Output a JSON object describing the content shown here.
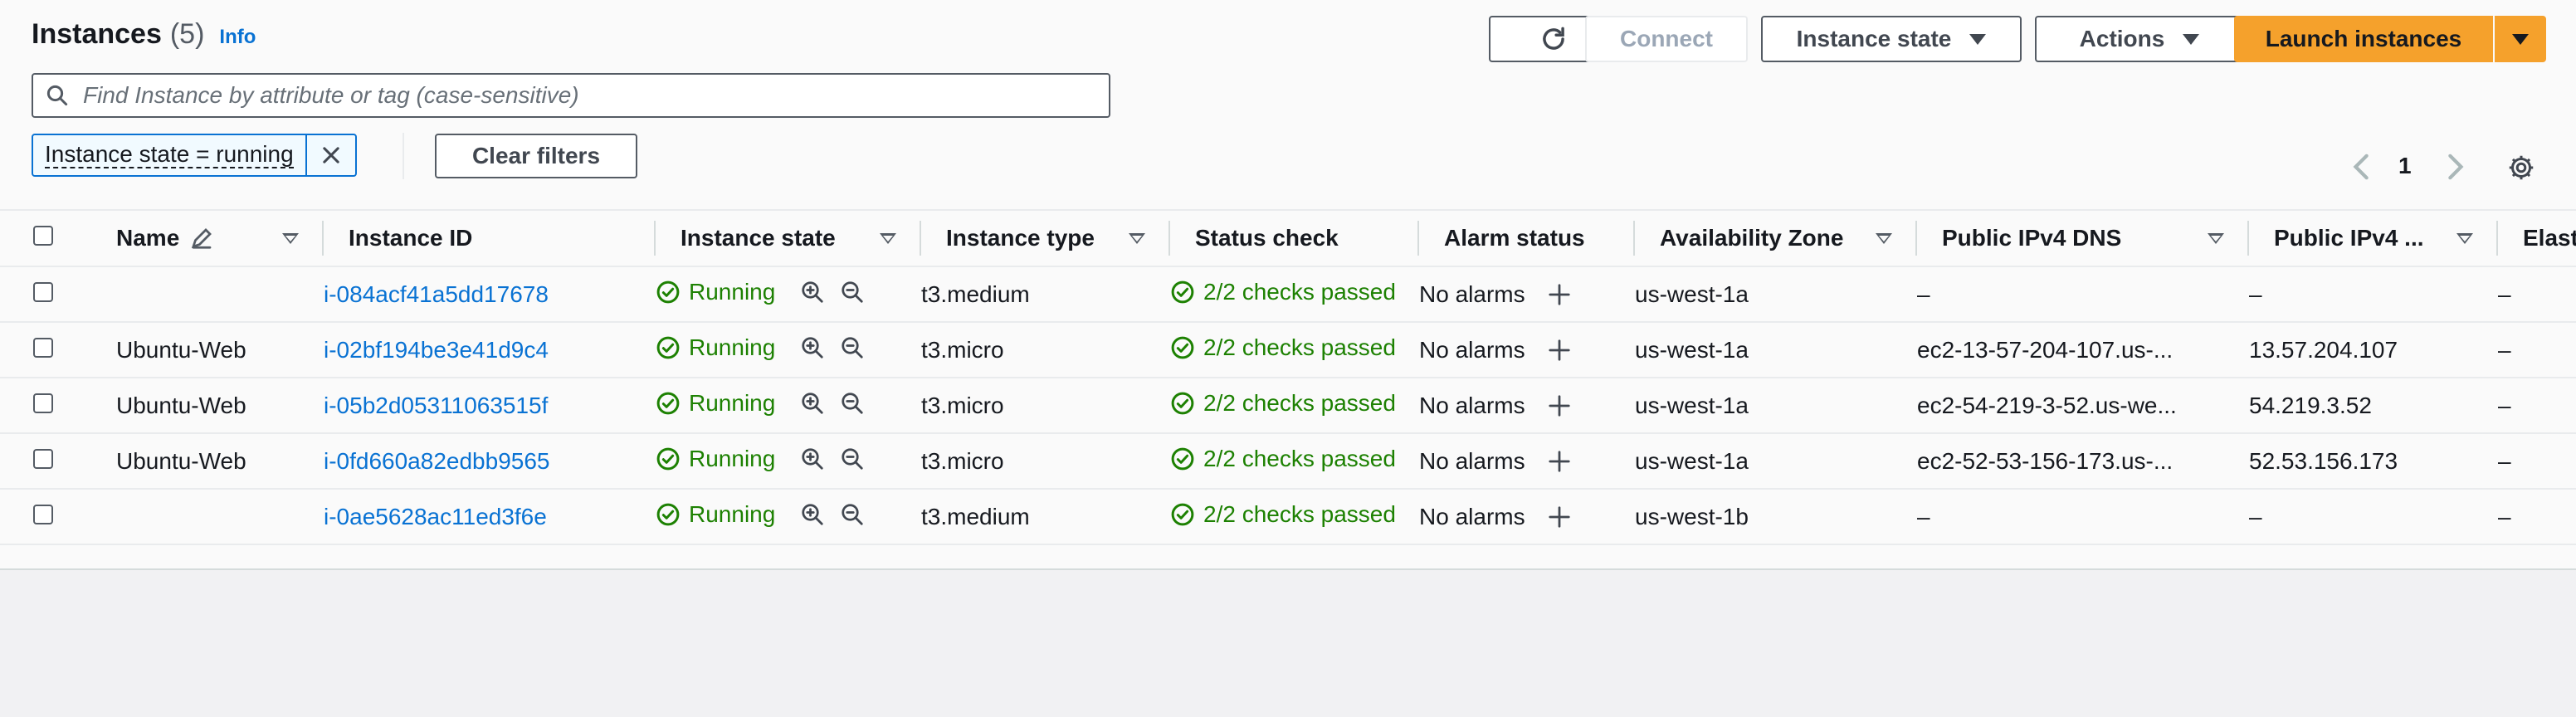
{
  "header": {
    "title": "Instances",
    "count": "(5)",
    "info_link": "Info"
  },
  "toolbar": {
    "connect_label": "Connect",
    "instance_state_label": "Instance state",
    "actions_label": "Actions",
    "launch_label": "Launch instances"
  },
  "search": {
    "placeholder": "Find Instance by attribute or tag (case-sensitive)",
    "value": ""
  },
  "filters": {
    "token_label": "Instance state = running",
    "clear_label": "Clear filters"
  },
  "pagination": {
    "current_page": "1"
  },
  "table": {
    "columns": [
      "Name",
      "Instance ID",
      "Instance state",
      "Instance type",
      "Status check",
      "Alarm status",
      "Availability Zone",
      "Public IPv4 DNS",
      "Public IPv4 ...",
      "Elast"
    ],
    "rows": [
      {
        "name": "",
        "instance_id": "i-084acf41a5dd17678",
        "state": "Running",
        "type": "t3.medium",
        "status_check": "2/2 checks passed",
        "alarm": "No alarms",
        "az": "us-west-1a",
        "dns": "–",
        "ipv4": "–",
        "elastic": "–"
      },
      {
        "name": "Ubuntu-Web",
        "instance_id": "i-02bf194be3e41d9c4",
        "state": "Running",
        "type": "t3.micro",
        "status_check": "2/2 checks passed",
        "alarm": "No alarms",
        "az": "us-west-1a",
        "dns": "ec2-13-57-204-107.us-...",
        "ipv4": "13.57.204.107",
        "elastic": "–"
      },
      {
        "name": "Ubuntu-Web",
        "instance_id": "i-05b2d05311063515f",
        "state": "Running",
        "type": "t3.micro",
        "status_check": "2/2 checks passed",
        "alarm": "No alarms",
        "az": "us-west-1a",
        "dns": "ec2-54-219-3-52.us-we...",
        "ipv4": "54.219.3.52",
        "elastic": "–"
      },
      {
        "name": "Ubuntu-Web",
        "instance_id": "i-0fd660a82edbb9565",
        "state": "Running",
        "type": "t3.micro",
        "status_check": "2/2 checks passed",
        "alarm": "No alarms",
        "az": "us-west-1a",
        "dns": "ec2-52-53-156-173.us-...",
        "ipv4": "52.53.156.173",
        "elastic": "–"
      },
      {
        "name": "",
        "instance_id": "i-0ae5628ac11ed3f6e",
        "state": "Running",
        "type": "t3.medium",
        "status_check": "2/2 checks passed",
        "alarm": "No alarms",
        "az": "us-west-1b",
        "dns": "–",
        "ipv4": "–",
        "elastic": "–"
      }
    ]
  },
  "colors": {
    "link": "#0972d3",
    "success": "#1d8102",
    "primary_button": "#f5a12c",
    "border": "#545b64"
  },
  "icons": {
    "refresh": "refresh-icon",
    "search": "search-icon",
    "close": "close-icon",
    "edit": "pencil-icon",
    "running": "check-circle-icon",
    "zoom_in": "zoom-in-icon",
    "zoom_out": "zoom-out-icon",
    "add_alarm": "plus-icon",
    "settings": "gear-icon",
    "prev": "chevron-left-icon",
    "next": "chevron-right-icon"
  }
}
